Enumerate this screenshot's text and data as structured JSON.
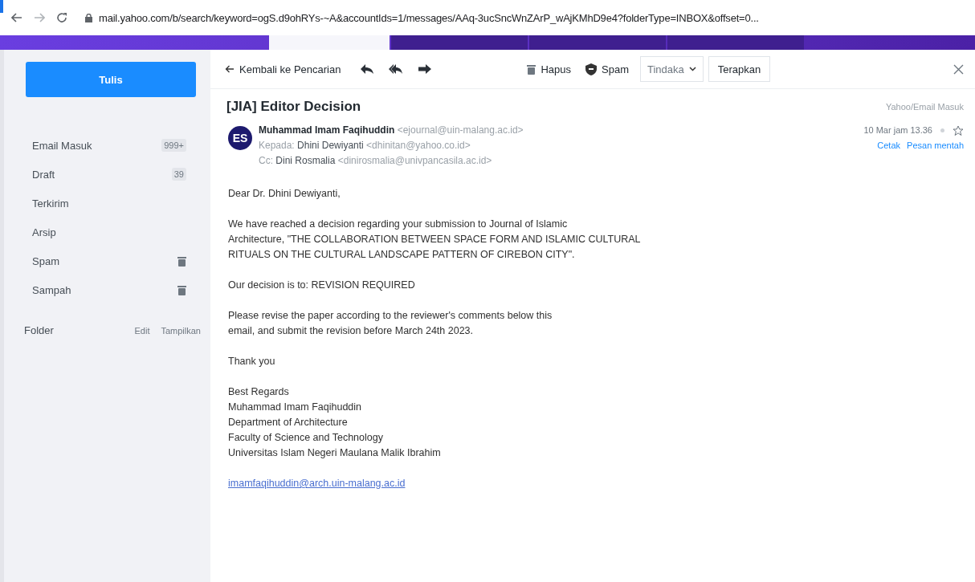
{
  "browser": {
    "url": "mail.yahoo.com/b/search/keyword=ogS.d9ohRYs-~A&accountIds=1/messages/AAq-3ucSncWnZArP_wAjKMhD9e4?folderType=INBOX&offset=0..."
  },
  "tabs": [
    {
      "selected": true
    },
    {
      "selected": false
    },
    {
      "selected": false
    },
    {
      "selected": false
    }
  ],
  "sidebar": {
    "compose": "Tulis",
    "folders": [
      {
        "name": "Email Masuk",
        "kind": "count",
        "count": "999+"
      },
      {
        "name": "Draft",
        "kind": "count",
        "count": "39"
      },
      {
        "name": "Terkirim",
        "kind": "plain"
      },
      {
        "name": "Arsip",
        "kind": "plain"
      },
      {
        "name": "Spam",
        "kind": "trash"
      },
      {
        "name": "Sampah",
        "kind": "trash"
      }
    ],
    "folder_header": {
      "label": "Folder",
      "actions": [
        "Edit",
        "Tampilkan"
      ]
    }
  },
  "toolbar": {
    "back": "Kembali ke Pencarian",
    "actions": [
      {
        "label": "Hapus",
        "kind": "trash"
      },
      {
        "label": "Spam",
        "kind": "shield"
      }
    ],
    "dropdown": "Tindaka",
    "apply": "Terapkan"
  },
  "message": {
    "subject": "[JIA] Editor Decision",
    "folder": "Yahoo/Email Masuk",
    "avatar": "ES",
    "from_name": "Muhammad Imam Faqihuddin",
    "from_email": "<ejournal@uin-malang.ac.id>",
    "recipients": [
      {
        "label": "Kepada:",
        "name": "Dhini Dewiyanti",
        "email": "<dhinitan@yahoo.co.id>"
      },
      {
        "label": "Cc:",
        "name": "Dini Rosmalia",
        "email": "<dinirosmalia@univpancasila.ac.id>"
      }
    ],
    "date": "10 Mar jam 13.36",
    "links": [
      "Cetak",
      "Pesan mentah"
    ],
    "paragraphs": [
      [
        "Dear Dr. Dhini Dewiyanti,"
      ],
      [
        "We have reached a decision regarding your submission to Journal of Islamic",
        "Architecture, \"THE COLLABORATION BETWEEN SPACE FORM AND ISLAMIC CULTURAL",
        "RITUALS ON THE CULTURAL LANDSCAPE PATTERN OF CIREBON CITY\"."
      ],
      [
        "Our decision is to: REVISION REQUIRED"
      ],
      [
        "Please revise the paper according to the reviewer's comments below this",
        "email, and submit the revision before March 24th 2023."
      ],
      [
        "Thank you"
      ],
      [
        "Best Regards",
        "Muhammad Imam Faqihuddin",
        "Department of Architecture",
        "Faculty of Science and Technology",
        "Universitas Islam Negeri Maulana Malik Ibrahim"
      ]
    ],
    "signature_link": "imamfaqihuddin@arch.uin-malang.ac.id"
  }
}
